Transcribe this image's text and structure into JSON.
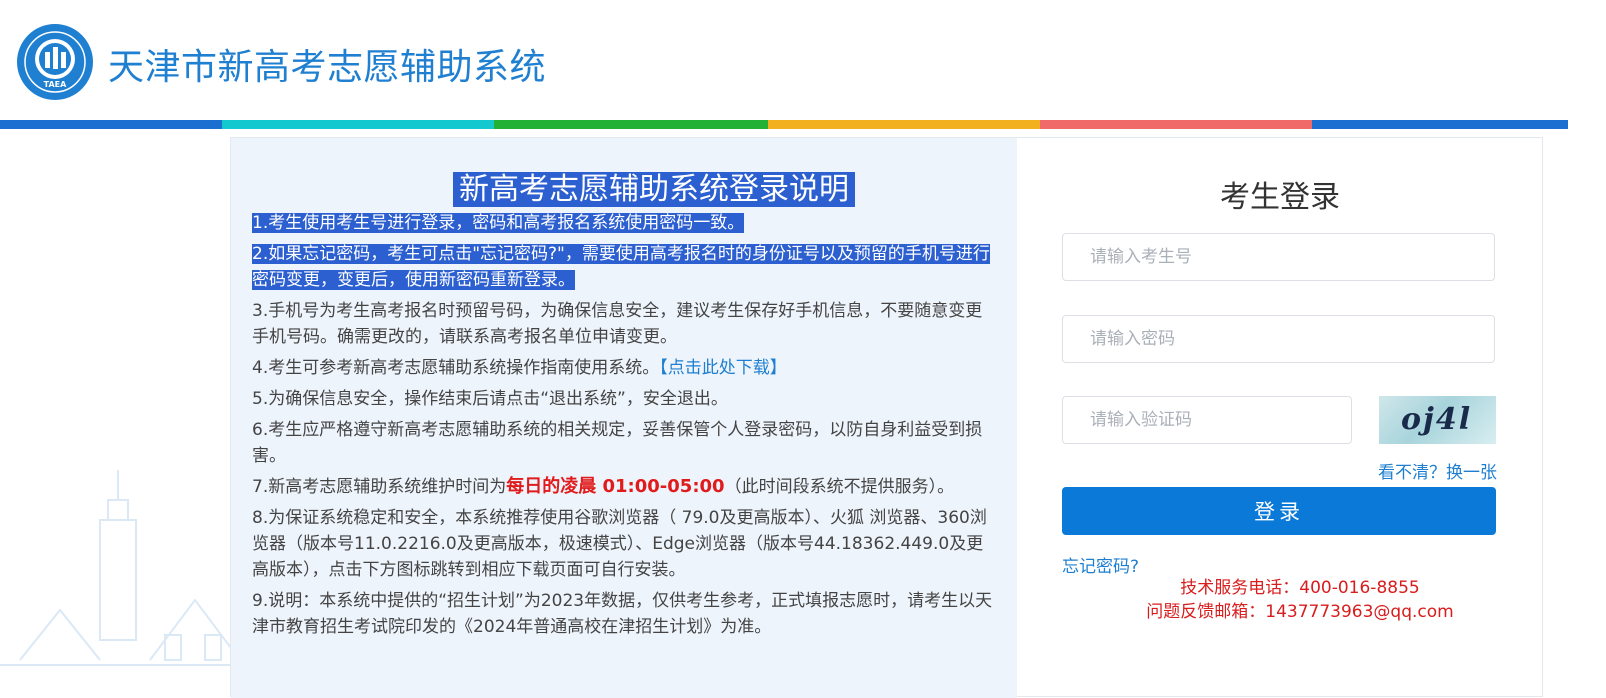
{
  "header": {
    "title": "天津市新高考志愿辅助系统",
    "logo_text": "TAEA"
  },
  "colors": {
    "brand_blue": "#1f7fd0",
    "stripe": [
      "#1b6fd0",
      "#13c9cf",
      "#22b035",
      "#f2b01e",
      "#f06a6a",
      "#1b6fd0"
    ],
    "highlight": "#2c5fcf",
    "notice_red": "#e01b1b",
    "login_button": "#0a79d8"
  },
  "notice": {
    "title": "新高考志愿辅助系统登录说明",
    "item1": "1.考生使用考生号进行登录，密码和高考报名系统使用密码一致。",
    "item2": "2.如果忘记密码，考生可点击\"忘记密码?\"，需要使用高考报名时的身份证号以及预留的手机号进行密码变更，变更后，使用新密码重新登录。",
    "item3": "3.手机号为考生高考报名时预留号码，为确保信息安全，建议考生保存好手机信息，不要随意变更手机号码。确需更改的，请联系高考报名单位申请变更。",
    "item4_text": "4.考生可参考新高考志愿辅助系统操作指南使用系统。",
    "item4_link": "【点击此处下载】",
    "item5": "5.为确保信息安全，操作结束后请点击“退出系统”，安全退出。",
    "item6": "6.考生应严格遵守新高考志愿辅助系统的相关规定，妥善保管个人登录密码，以防自身利益受到损害。",
    "item7_pre": "7.新高考志愿辅助系统维护时间为",
    "item7_bold": "每日的凌晨 01:00-05:00",
    "item7_post": "（此时间段系统不提供服务）。",
    "item8": "8.为保证系统稳定和安全，本系统推荐使用谷歌浏览器（ 79.0及更高版本）、火狐 浏览器、360浏览器（版本号11.0.2216.0及更高版本，极速模式）、Edge浏览器（版本号44.18362.449.0及更高版本），点击下方图标跳转到相应下载页面可自行安装。",
    "item9": "9.说明：本系统中提供的“招生计划”为2023年数据，仅供考生参考，正式填报志愿时，请考生以天津市教育招生考试院印发的《2024年普通高校在津招生计划》为准。"
  },
  "login": {
    "title": "考生登录",
    "candidate_placeholder": "请输入考生号",
    "password_placeholder": "请输入密码",
    "captcha_placeholder": "请输入验证码",
    "captcha_text": "oj4l",
    "refresh_label": "看不清？换一张",
    "submit_label": "登录",
    "forgot_label": "忘记密码?",
    "support_phone": "技术服务电话：400-016-8855",
    "support_email": "问题反馈邮箱：1437773963@qq.com"
  }
}
